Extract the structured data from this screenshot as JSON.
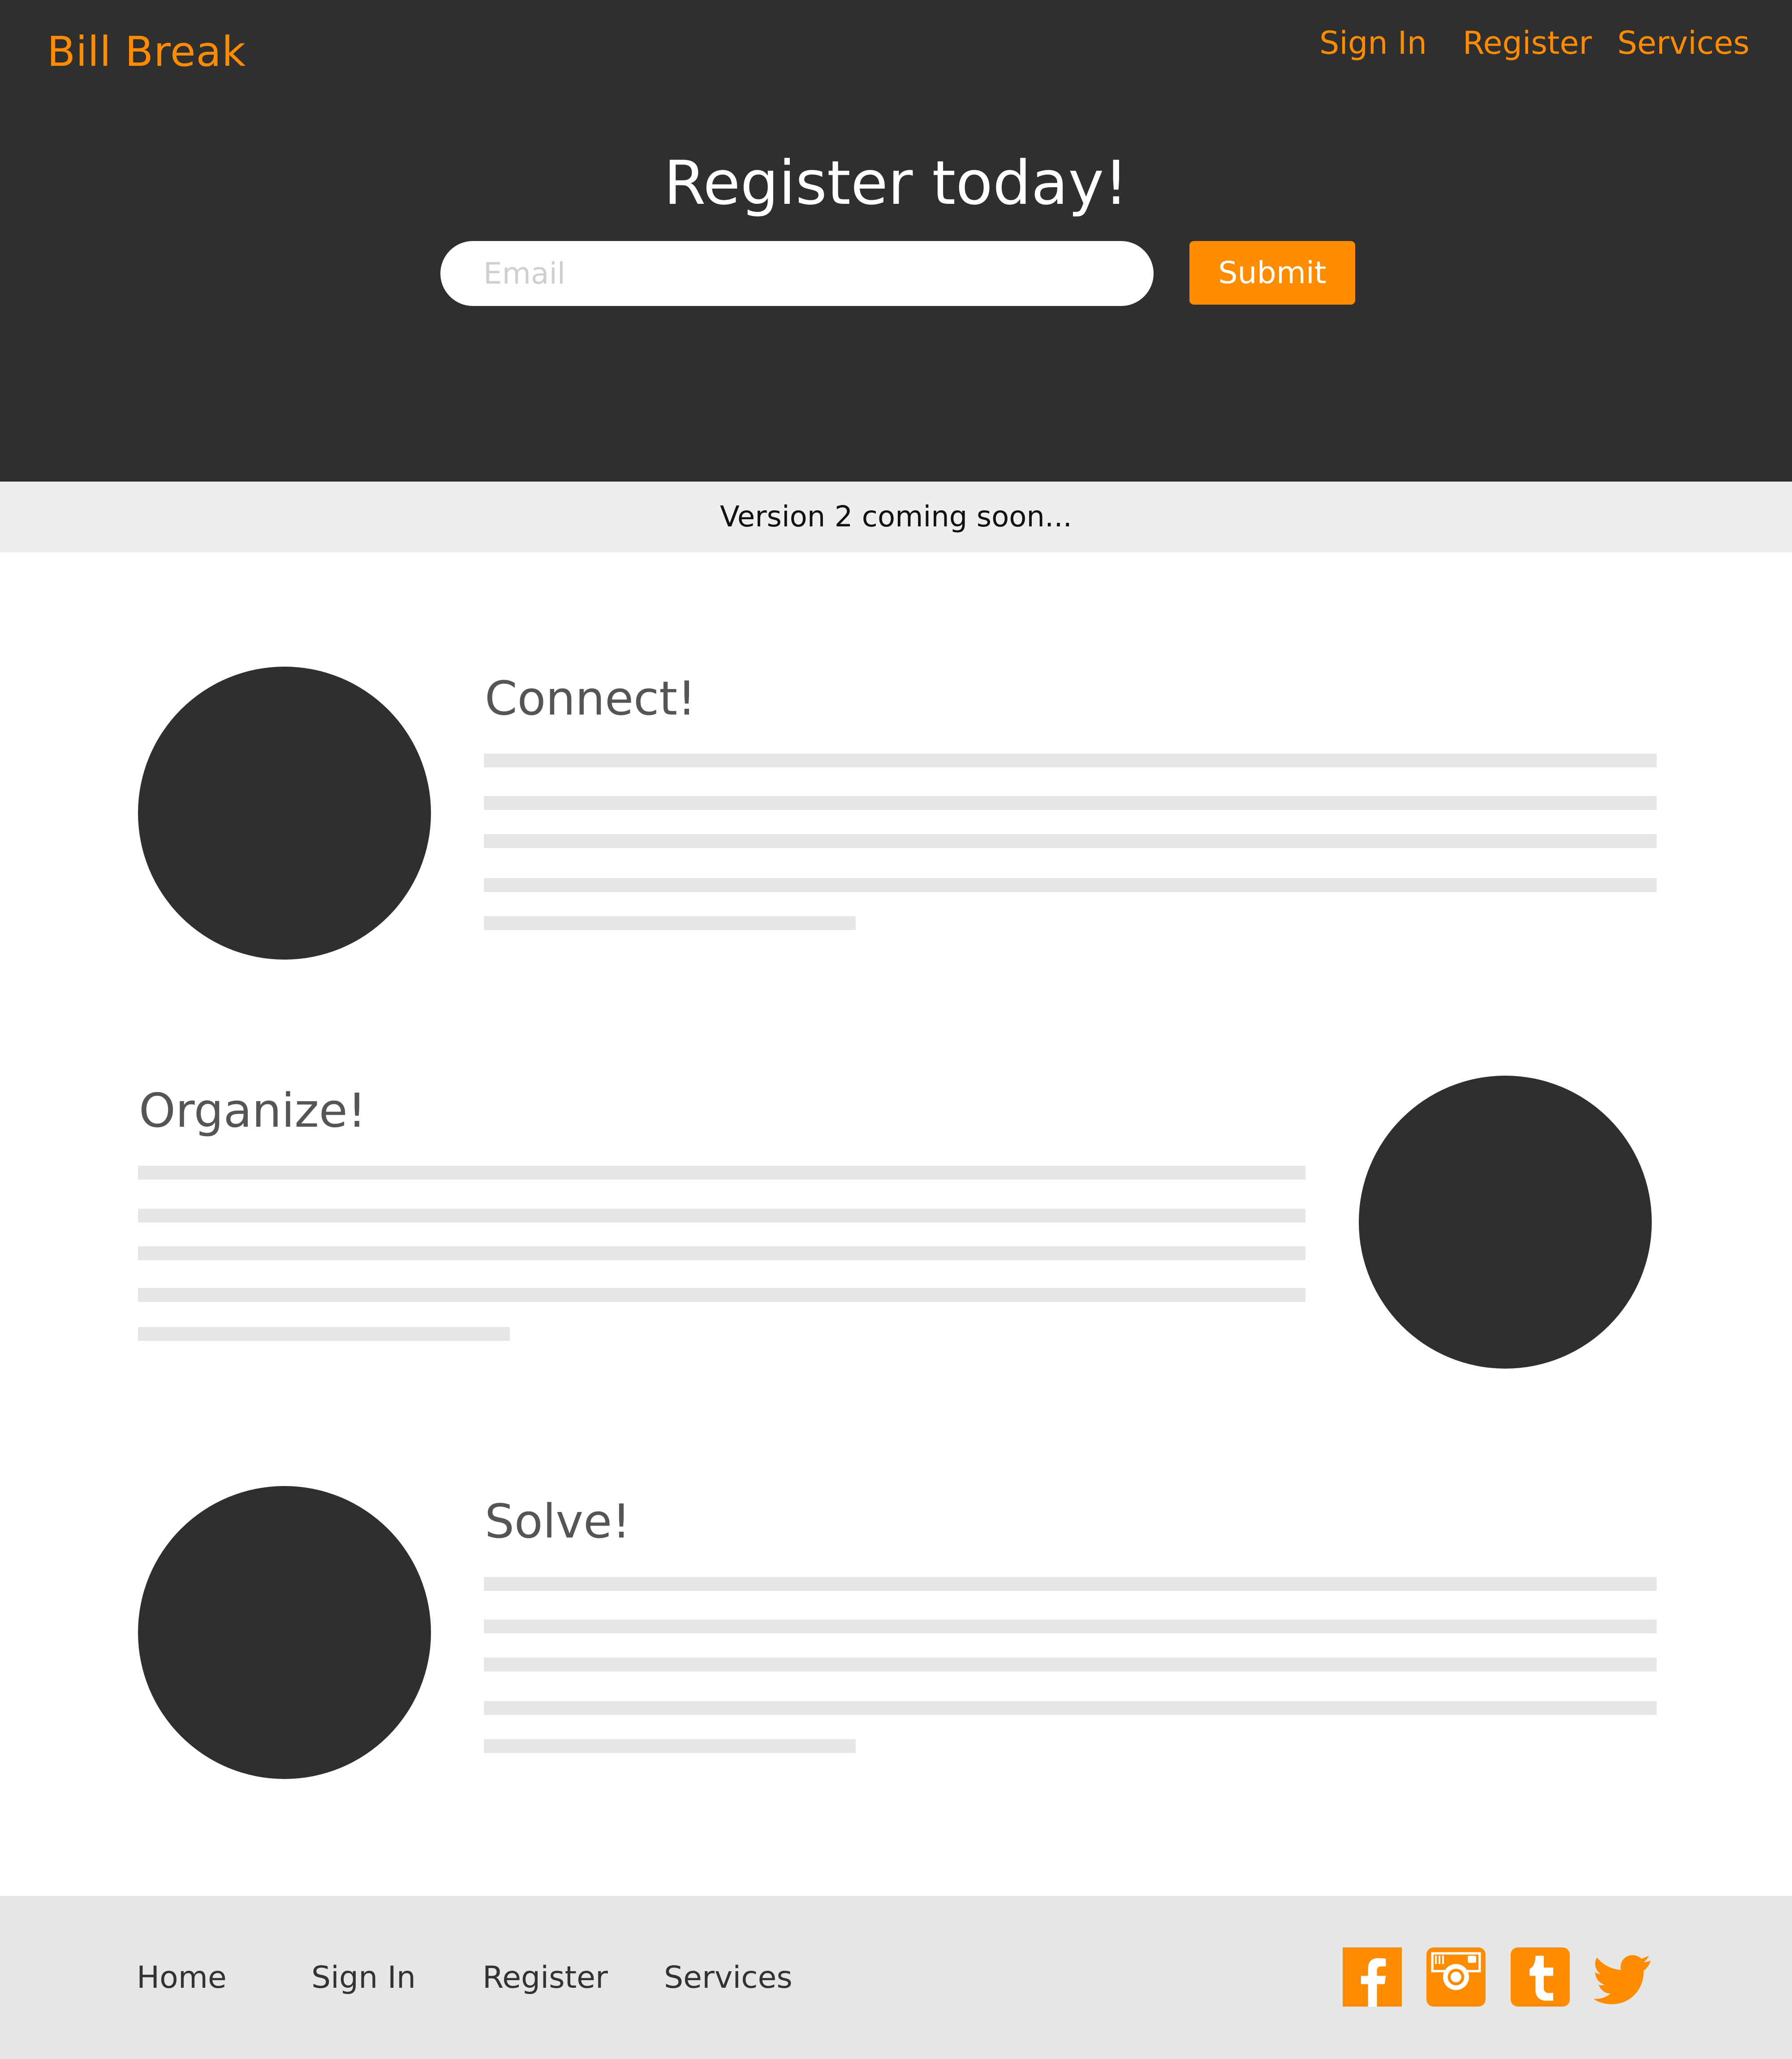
{
  "header": {
    "logo": "Bill Break",
    "nav": {
      "sign_in": "Sign In",
      "register": "Register",
      "services": "Services"
    },
    "hero_title": "Register today!",
    "email_placeholder": "Email",
    "submit_label": "Submit"
  },
  "banner": {
    "text": "Version 2 coming soon..."
  },
  "features": [
    {
      "title": "Connect!"
    },
    {
      "title": "Organize!"
    },
    {
      "title": "Solve!"
    }
  ],
  "footer": {
    "links": {
      "home": "Home",
      "sign_in": "Sign In",
      "register": "Register",
      "services": "Services"
    },
    "social_icons": [
      "facebook-icon",
      "instagram-icon",
      "tumblr-icon",
      "twitter-icon"
    ]
  },
  "colors": {
    "accent": "#ff8c00",
    "dark": "#2f2f2f",
    "banner_bg": "#eeeeee",
    "footer_bg": "#e6e6e6",
    "placeholder_line": "#e6e6e6"
  }
}
